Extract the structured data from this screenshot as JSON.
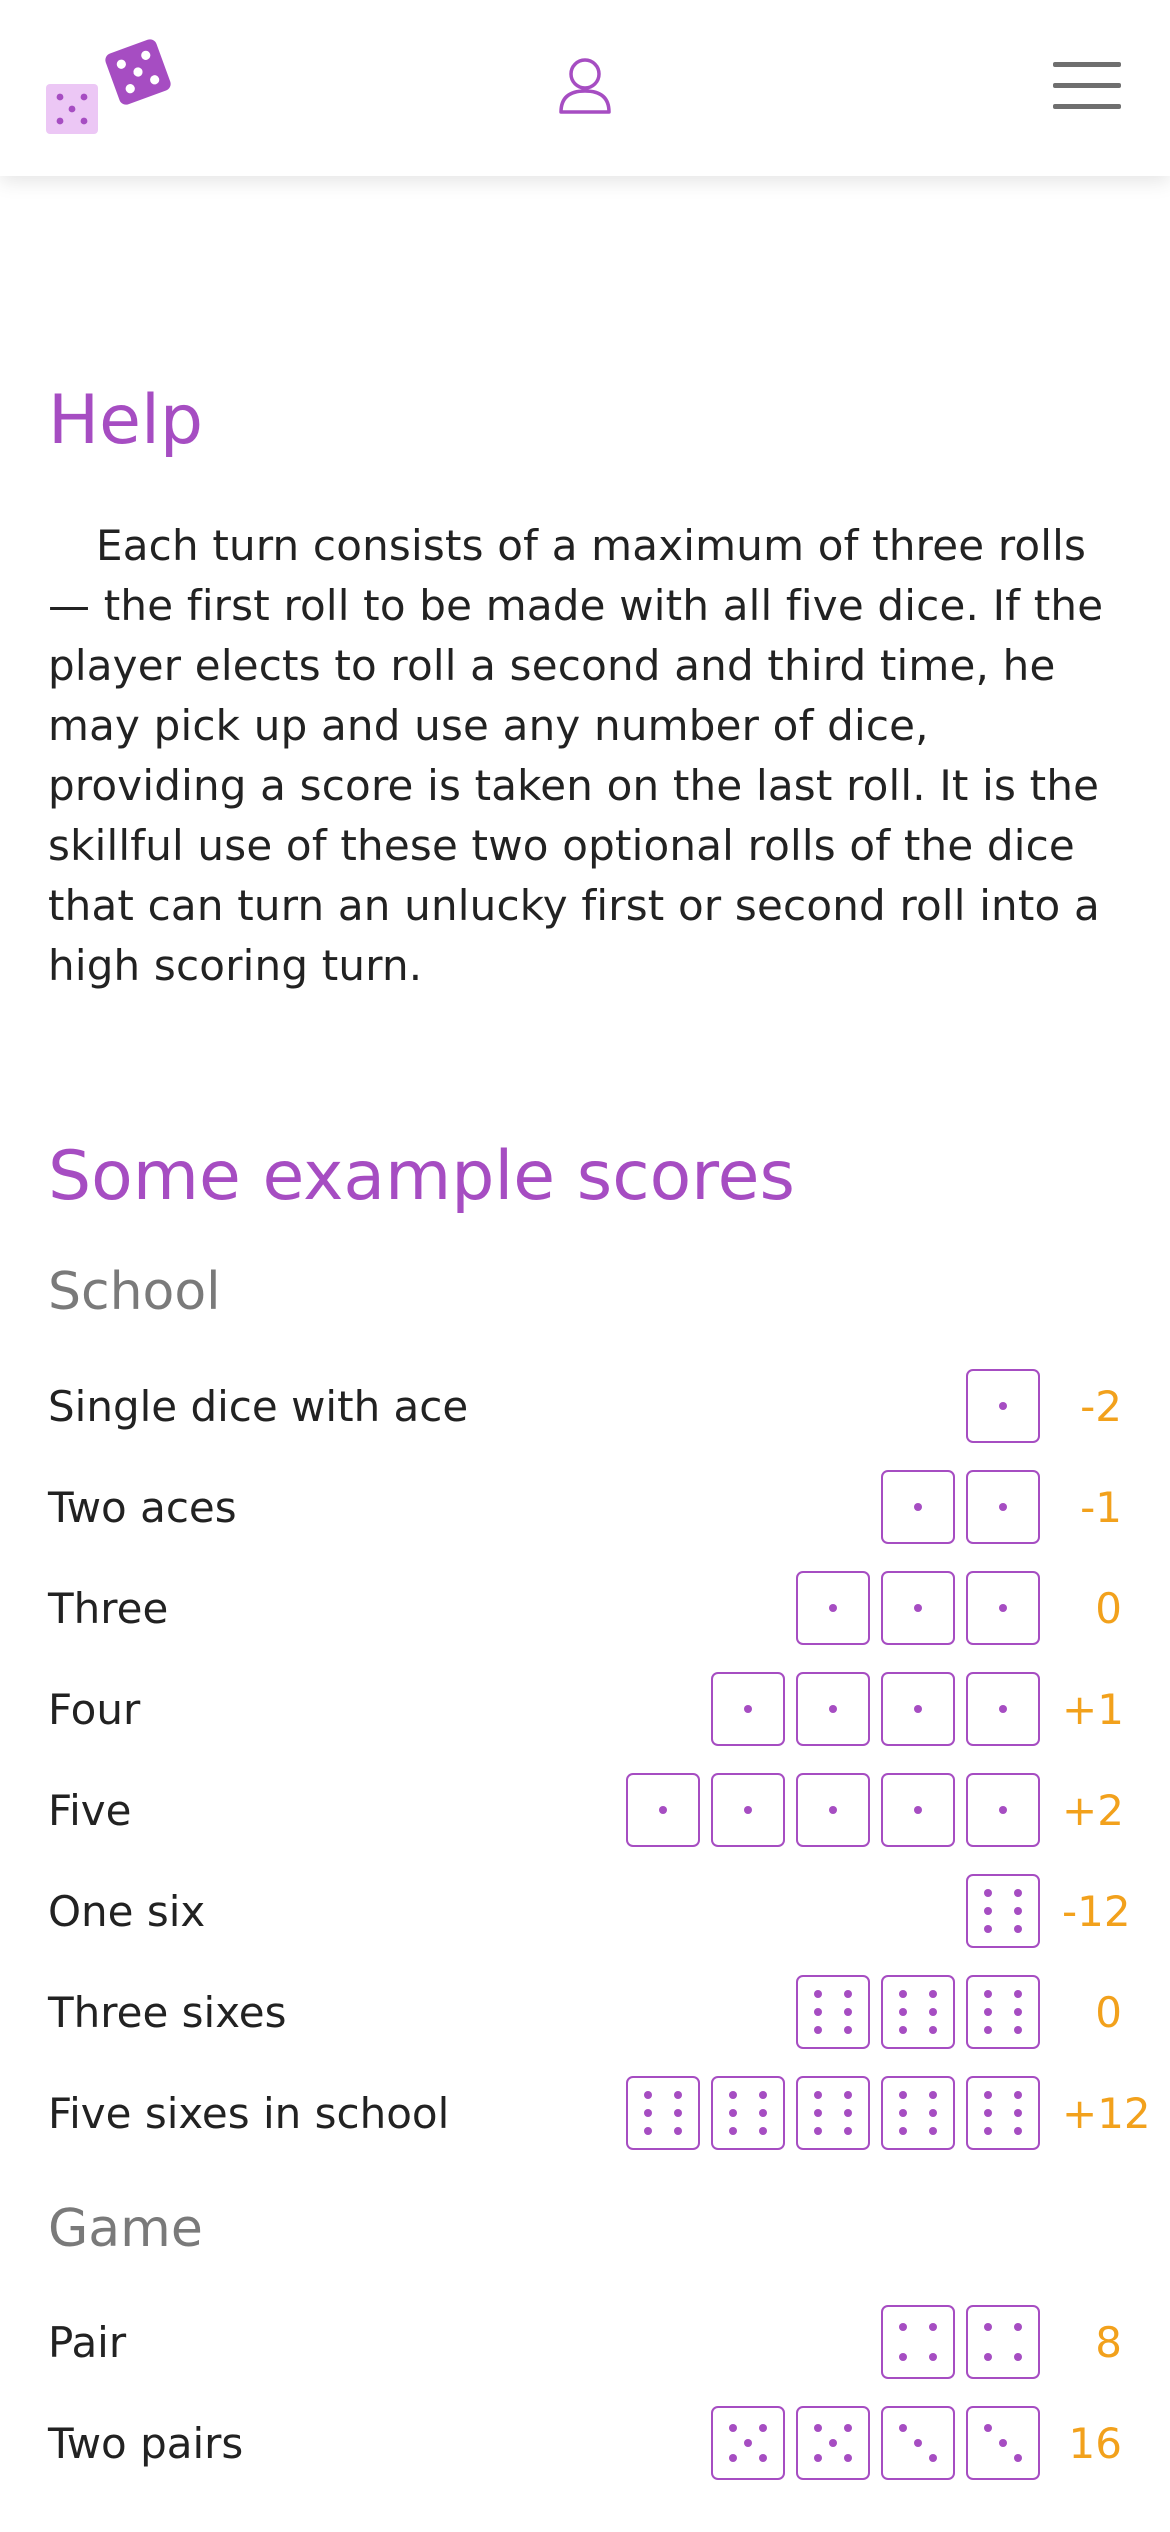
{
  "header": {
    "logo_icon": "dice-logo-icon",
    "user_icon": "user-icon",
    "menu_icon": "hamburger-menu-icon"
  },
  "colors": {
    "accent": "#a64dc2",
    "score": "#f2a11c",
    "subheading": "#7a7a7a",
    "text": "#222222"
  },
  "page": {
    "title": "Help",
    "intro": "Each turn consists of a maximum of three rolls — the first roll to be made with all five dice. If the player elects to roll a second and third time, he may pick up and use any number of dice, providing a score is taken on the last roll. It is the skillful use of these two optional rolls of the dice that can turn an unlucky first or second roll into a high scoring turn.",
    "section_title": "Some example scores"
  },
  "groups": [
    {
      "title": "School",
      "rows": [
        {
          "label": "Single dice with ace",
          "dice": [
            1
          ],
          "score": "-2"
        },
        {
          "label": "Two aces",
          "dice": [
            1,
            1
          ],
          "score": "-1"
        },
        {
          "label": "Three",
          "dice": [
            1,
            1,
            1
          ],
          "score": "0"
        },
        {
          "label": "Four",
          "dice": [
            1,
            1,
            1,
            1
          ],
          "score": "+1"
        },
        {
          "label": "Five",
          "dice": [
            1,
            1,
            1,
            1,
            1
          ],
          "score": "+2"
        },
        {
          "label": "One six",
          "dice": [
            6
          ],
          "score": "-12"
        },
        {
          "label": "Three sixes",
          "dice": [
            6,
            6,
            6
          ],
          "score": "0"
        },
        {
          "label": "Five sixes in school",
          "dice": [
            6,
            6,
            6,
            6,
            6
          ],
          "score": "+12"
        }
      ]
    },
    {
      "title": "Game",
      "rows": [
        {
          "label": "Pair",
          "dice": [
            4,
            4
          ],
          "score": "8"
        },
        {
          "label": "Two pairs",
          "dice": [
            5,
            5,
            3,
            3
          ],
          "score": "16"
        }
      ]
    }
  ]
}
